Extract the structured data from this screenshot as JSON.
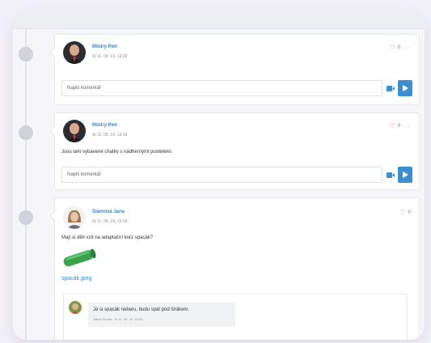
{
  "posts": [
    {
      "author": "Műdrý Petr",
      "date": "St 11. 09. 19, 13:33",
      "likes": "0",
      "comment_placeholder": "Napiš komentář"
    },
    {
      "author": "Műdrý Petr",
      "date": "St 11. 09. 19, 13:33",
      "likes": "0",
      "text": "Jsou tam vybavené chatky s nádhernými postelemi.",
      "comment_placeholder": "Napiš komentář"
    },
    {
      "author": "Slámová Jana",
      "date": "St 11. 09. 19, 13:29",
      "likes": "0",
      "text": "Mají si děti vzít na adaptační kurz spacák?",
      "attachment": "spacák.jpeg",
      "reply": {
        "text": "Já si spacák neberu, budu spát pod širákem.",
        "meta": "Jakub Sloma · St 11. 09. 19, 13:30"
      }
    }
  ],
  "colors": {
    "accent": "#3a8fd1",
    "heart": "#e45b6b",
    "link": "#3a86c8"
  },
  "icons": {
    "like": "heart-outline-icon",
    "more": "ellipsis-icon",
    "video": "video-camera-icon",
    "send": "send-arrow-icon"
  }
}
